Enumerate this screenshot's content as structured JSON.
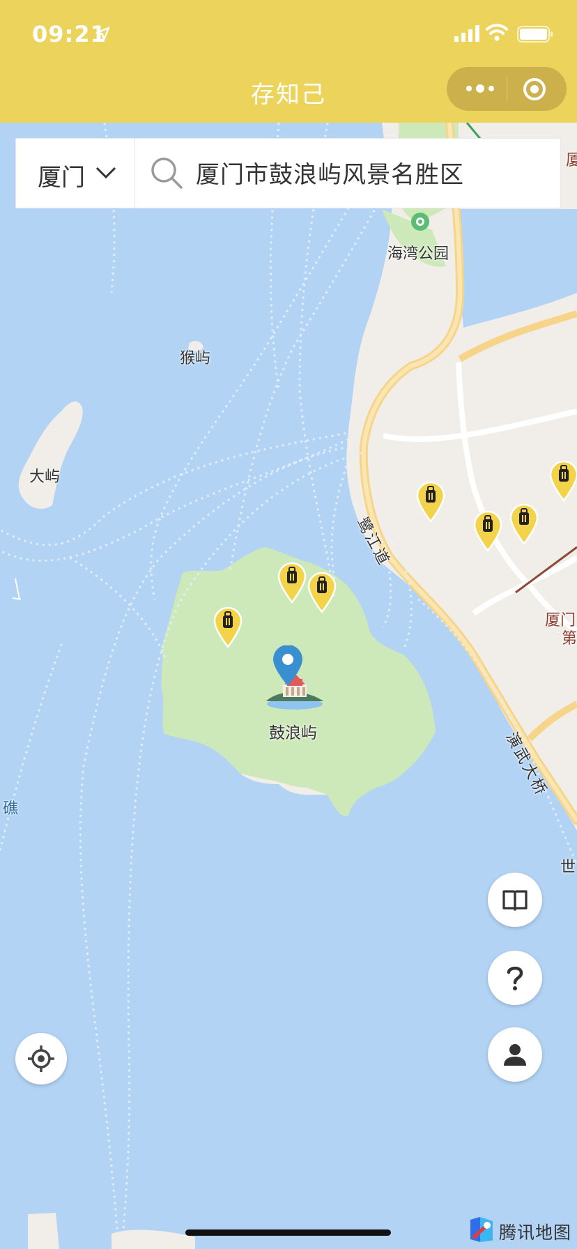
{
  "status_bar": {
    "time": "09:21"
  },
  "header": {
    "title": "存知己"
  },
  "search": {
    "city": "厦门",
    "query": "厦门市鼓浪屿风景名胜区"
  },
  "map": {
    "labels": {
      "houyu": "猴屿",
      "dayu": "大屿",
      "bay_park": "海湾公园",
      "gulangyu": "鼓浪屿",
      "lujiang_road": "鹭江道",
      "yanwu_bridge": "演武大桥",
      "xiamen_first": "厦门",
      "xiamen_first_2": "第",
      "reef_partial": "礁",
      "shi_partial": "世",
      "xia_partial": "厦"
    },
    "provider": "腾讯地图"
  },
  "colors": {
    "brand_yellow": "#ebd35c",
    "water": "#b3d3f5",
    "island": "#cde9b9",
    "road": "#f7d68a"
  },
  "icons": [
    "location-arrow-icon",
    "signal-icon",
    "wifi-icon",
    "battery-icon",
    "more-icon",
    "close-icon",
    "chevron-down-icon",
    "search-icon",
    "luggage-pin-icon",
    "destination-pin-icon",
    "book-icon",
    "help-icon",
    "user-icon",
    "locate-icon",
    "tencent-map-logo-icon"
  ]
}
